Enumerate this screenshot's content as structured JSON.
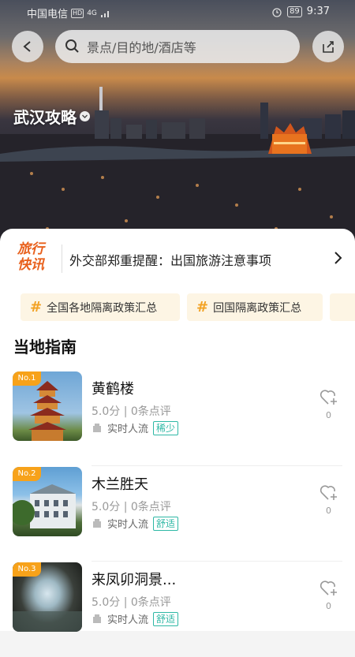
{
  "status_bar": {
    "carrier": "中国电信",
    "hd": "HD",
    "network": "4G",
    "battery": "89",
    "time": "9:37"
  },
  "header": {
    "search_placeholder": "景点/目的地/酒店等",
    "city_title": "武汉攻略"
  },
  "news": {
    "logo_line1": "旅行",
    "logo_line2": "快讯",
    "headline": "外交部郑重提醒：出国旅游注意事项"
  },
  "tags": [
    {
      "label": "全国各地隔离政策汇总"
    },
    {
      "label": "回国隔离政策汇总"
    }
  ],
  "section": {
    "title": "当地指南"
  },
  "attractions": [
    {
      "rank": "No.1",
      "name": "黄鹤楼",
      "rating": "5.0分 | 0条点评",
      "flow_label": "实时人流",
      "flow_status": "稀少",
      "fav_count": "0"
    },
    {
      "rank": "No.2",
      "name": "木兰胜天",
      "rating": "5.0分 | 0条点评",
      "flow_label": "实时人流",
      "flow_status": "舒适",
      "fav_count": "0"
    },
    {
      "rank": "No.3",
      "name": "来凤卯洞景...",
      "rating": "5.0分 | 0条点评",
      "flow_label": "实时人流",
      "flow_status": "舒适",
      "fav_count": "0"
    }
  ],
  "colors": {
    "accent_orange": "#f7a21a",
    "flow_teal": "#2eb8a5",
    "news_logo": "#e8601c"
  }
}
